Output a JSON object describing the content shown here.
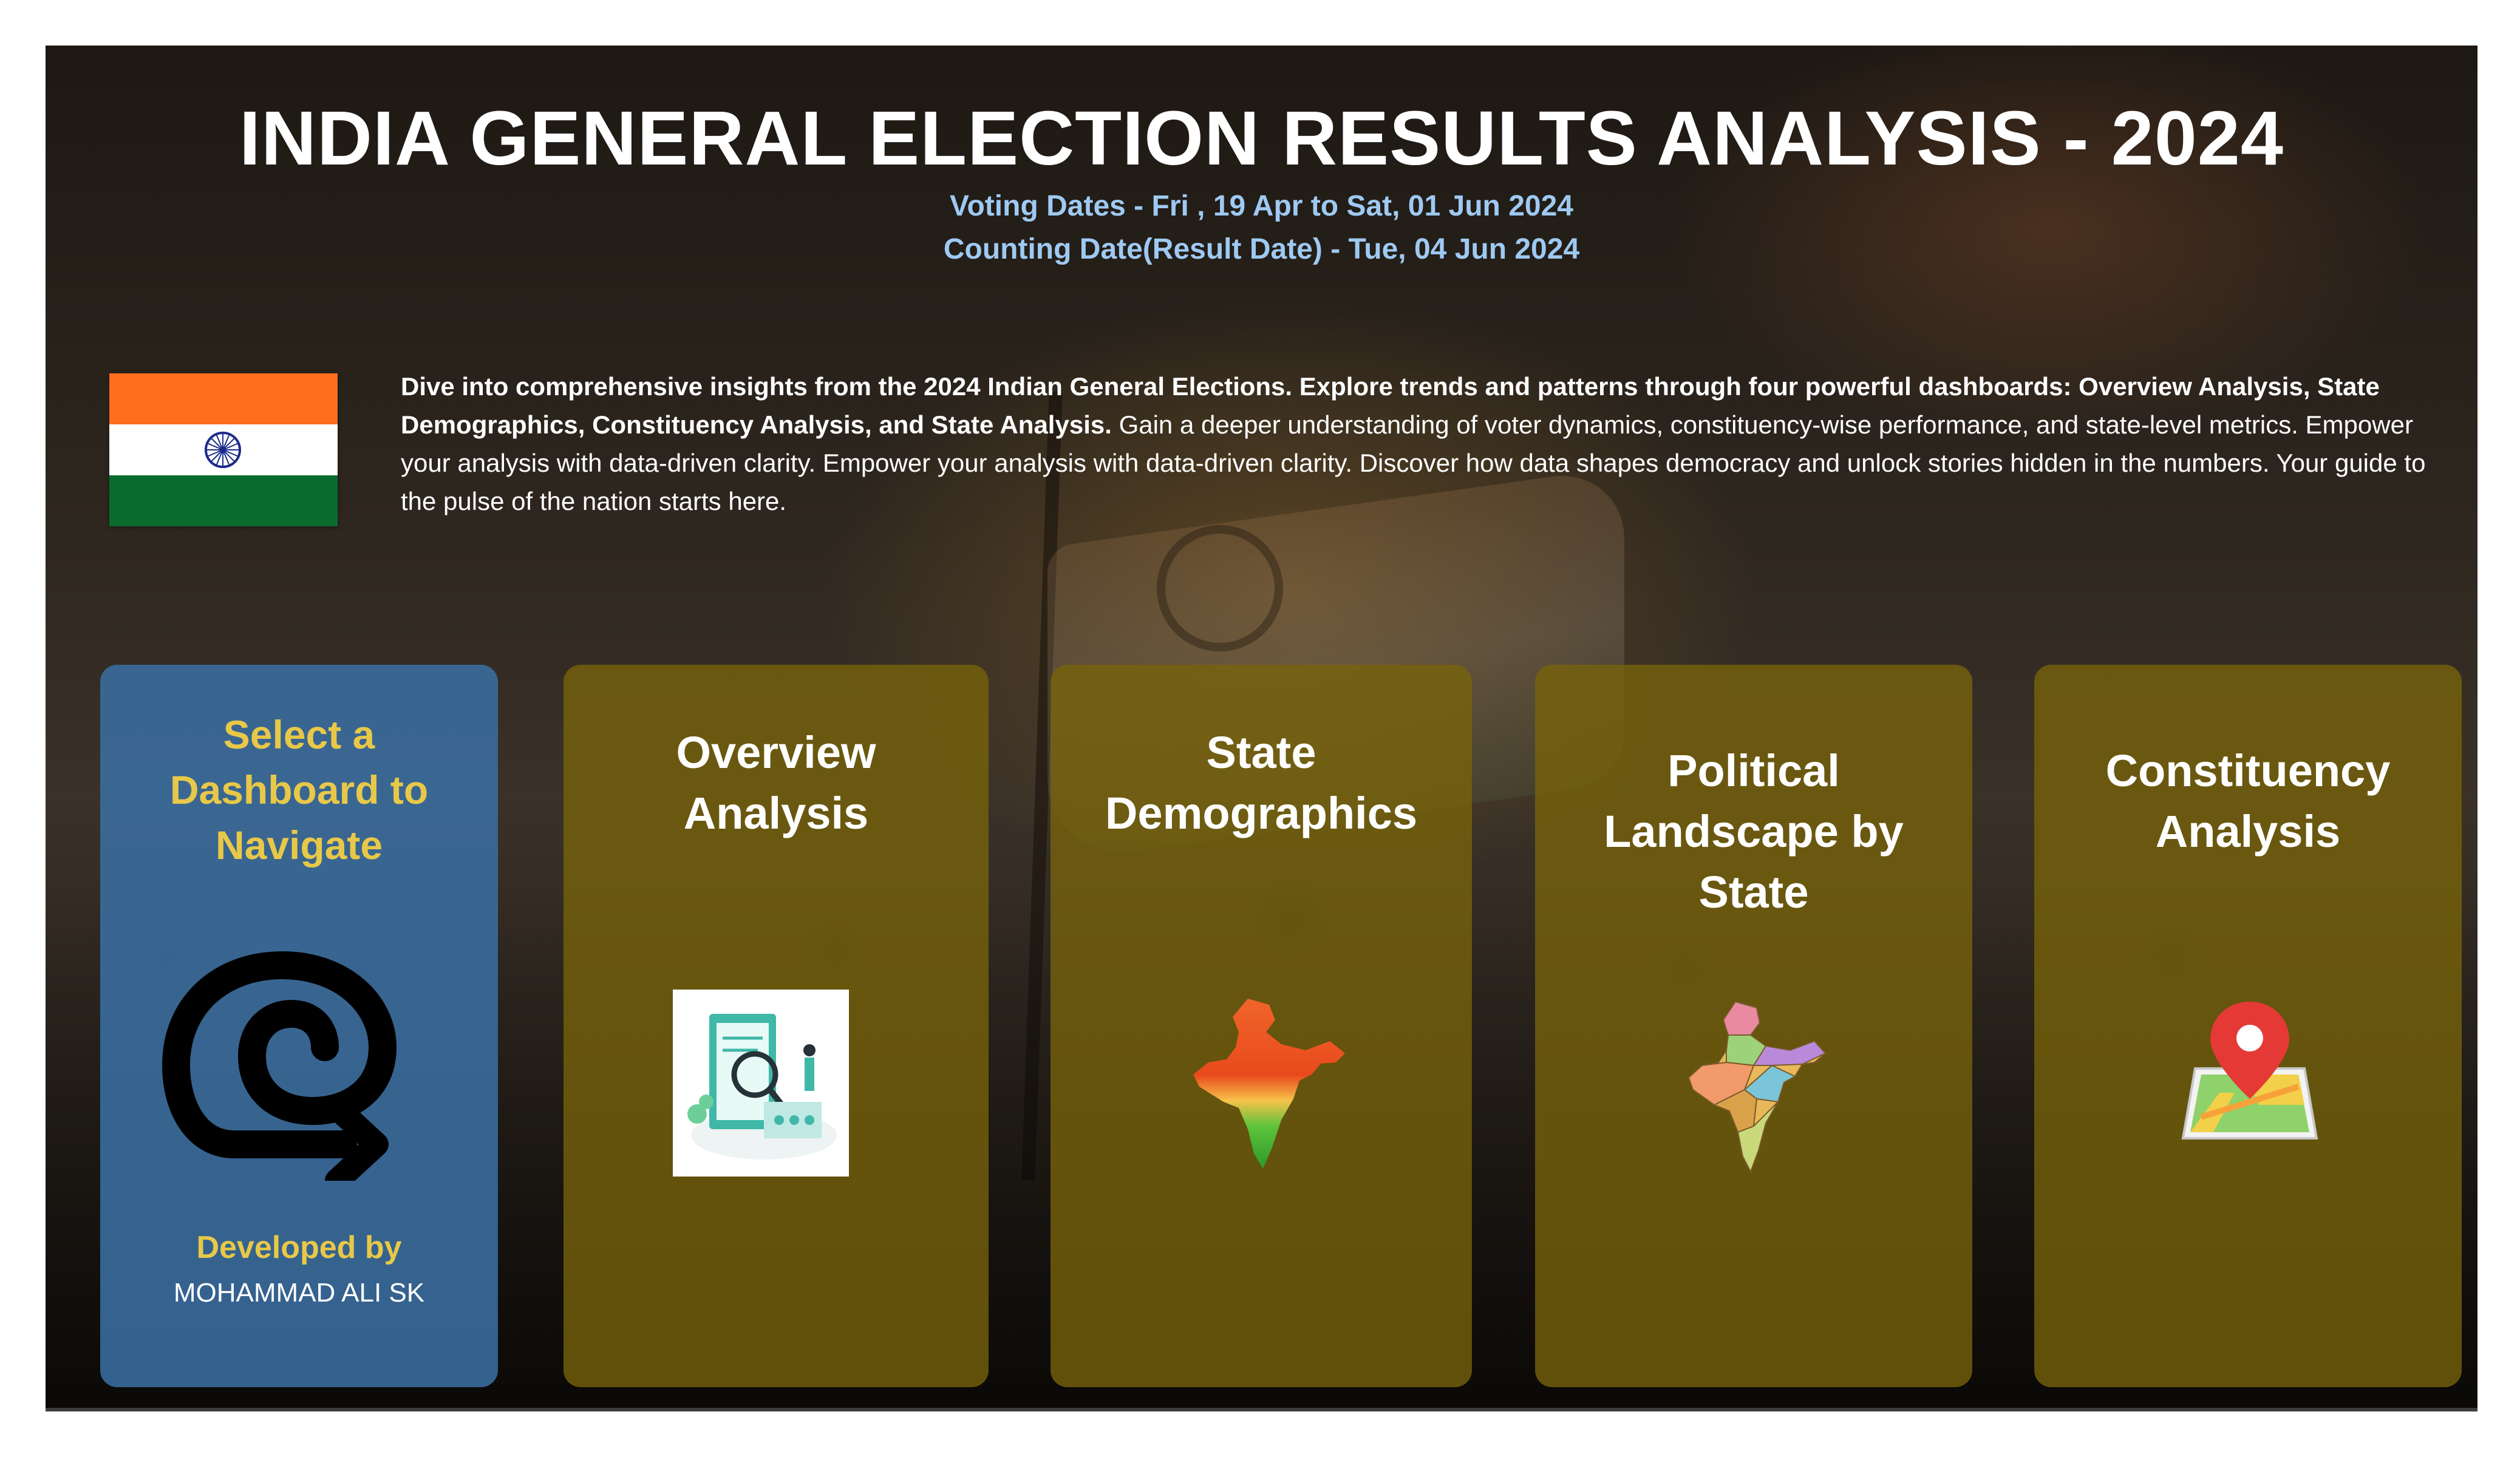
{
  "header": {
    "title": "INDIA GENERAL ELECTION RESULTS ANALYSIS - 2024",
    "voting_dates": "Voting Dates - Fri , 19 Apr to Sat, 01 Jun 2024",
    "counting_date": "Counting Date(Result Date) - Tue, 04 Jun 2024"
  },
  "intro": {
    "bold_text": "Dive into comprehensive insights from the 2024 Indian General Elections. Explore trends and patterns through four powerful dashboards: Overview Analysis, State Demographics, Constituency Analysis, and State Analysis.",
    "body_text": " Gain a deeper understanding of voter dynamics, constituency-wise performance, and state-level metrics. Empower your analysis with data-driven clarity. Empower your analysis with data-driven clarity. Discover how data shapes democracy and unlock stories hidden in the numbers. Your guide to the pulse of the nation starts here."
  },
  "nav_card": {
    "title_line1": "Select a",
    "title_line2": "Dashboard to",
    "title_line3": "Navigate",
    "icon": "navigate-arrow-icon",
    "developed_by_label": "Developed by",
    "developer_name": "MOHAMMAD ALI SK"
  },
  "dashboards": [
    {
      "line1": "Overview",
      "line2": "Analysis",
      "icon": "analysis-magnifier-icon"
    },
    {
      "line1": "State",
      "line2": "Demographics",
      "icon": "india-map-tricolor-icon"
    },
    {
      "line1": "Political",
      "line2": "Landscape by",
      "line3": "State",
      "icon": "india-states-map-icon"
    },
    {
      "line1": "Constituency",
      "line2": "Analysis",
      "icon": "map-pin-icon"
    }
  ],
  "colors": {
    "title": "#ffffff",
    "subtitle": "#9ec9f2",
    "nav_card_bg": "#3a6ea0",
    "nav_accent": "#e8c848",
    "dashboard_card_bg": "#786410",
    "flag_saffron": "#ff6d1f",
    "flag_green": "#0b6b2f"
  }
}
